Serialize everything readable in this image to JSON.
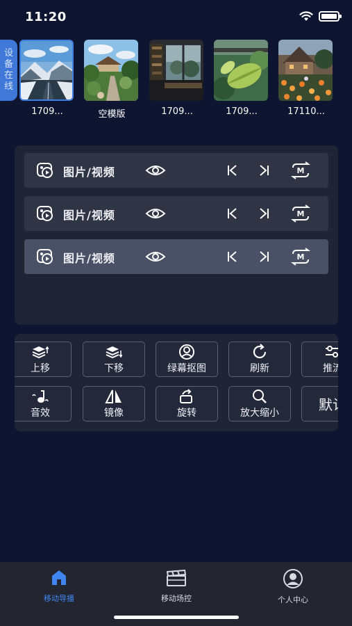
{
  "status_bar": {
    "time": "11:20"
  },
  "side_tab": {
    "label": "设备在线",
    "chars": [
      "设",
      "备",
      "在",
      "线"
    ]
  },
  "thumbnails": [
    {
      "label": "1709...",
      "scene": "snowy-road"
    },
    {
      "label": "空模版",
      "scene": "garden-path"
    },
    {
      "label": "1709...",
      "scene": "window-room"
    },
    {
      "label": "1709...",
      "scene": "leaf-closeup"
    },
    {
      "label": "17110...",
      "scene": "flower-house"
    }
  ],
  "media_rows": [
    {
      "label": "图片/视频",
      "active": false
    },
    {
      "label": "图片/视频",
      "active": false
    },
    {
      "label": "图片/视频",
      "active": true
    }
  ],
  "controls": {
    "row1": [
      {
        "label": "上移",
        "icon": "layers-up-icon"
      },
      {
        "label": "下移",
        "icon": "layers-down-icon"
      },
      {
        "label": "绿幕抠图",
        "icon": "person-circle-icon"
      },
      {
        "label": "刷新",
        "icon": "refresh-icon"
      },
      {
        "label": "推流",
        "icon": "sliders-icon"
      }
    ],
    "row2": [
      {
        "label": "音效",
        "icon": "music-note-icon"
      },
      {
        "label": "镜像",
        "icon": "mirror-icon"
      },
      {
        "label": "旋转",
        "icon": "rotate-icon"
      },
      {
        "label": "放大缩小",
        "icon": "zoom-icon"
      },
      {
        "label": "默认",
        "icon": ""
      }
    ]
  },
  "tabbar": [
    {
      "label": "移动导播",
      "icon": "home-icon",
      "active": true
    },
    {
      "label": "移动场控",
      "icon": "clapperboard-icon",
      "active": false
    },
    {
      "label": "个人中心",
      "icon": "user-icon",
      "active": false
    }
  ],
  "colors": {
    "background": "#0e1530",
    "panel": "#1f2535",
    "accent": "#3f7ee0",
    "tab_active": "#3f86f2"
  }
}
